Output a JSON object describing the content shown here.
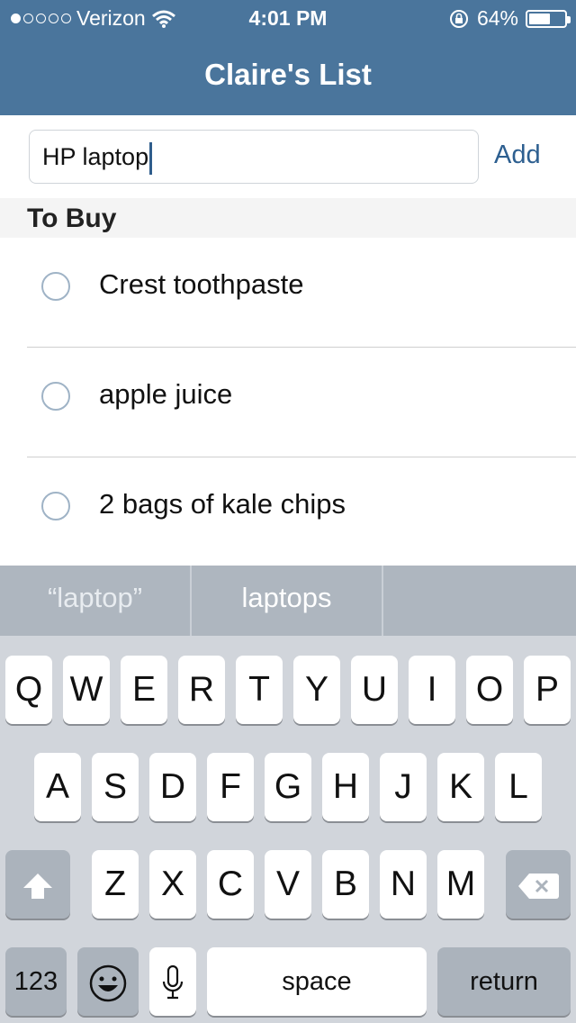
{
  "status": {
    "carrier": "Verizon",
    "signal_dots": [
      true,
      false,
      false,
      false,
      false
    ],
    "time": "4:01 PM",
    "battery_text": "64%",
    "battery_level": 0.64
  },
  "nav": {
    "title": "Claire's List"
  },
  "entry": {
    "value": "HP laptop",
    "add_label": "Add"
  },
  "section": {
    "title": "To Buy"
  },
  "items": [
    {
      "label": "Crest toothpaste"
    },
    {
      "label": "apple juice"
    },
    {
      "label": "2 bags of kale chips"
    }
  ],
  "keyboard": {
    "suggestions": [
      "“laptop”",
      "laptops",
      ""
    ],
    "row1": [
      "Q",
      "W",
      "E",
      "R",
      "T",
      "Y",
      "U",
      "I",
      "O",
      "P"
    ],
    "row2": [
      "A",
      "S",
      "D",
      "F",
      "G",
      "H",
      "J",
      "K",
      "L"
    ],
    "row3": [
      "Z",
      "X",
      "C",
      "V",
      "B",
      "N",
      "M"
    ],
    "numbers_label": "123",
    "space_label": "space",
    "return_label": "return"
  },
  "colors": {
    "nav": "#4a759c",
    "accent": "#2d5f90"
  },
  "icons": {
    "wifi": "wifi-icon",
    "lock_rotation": "rotation-lock-icon",
    "shift": "shift-icon",
    "backspace": "backspace-icon",
    "emoji": "emoji-icon",
    "mic": "microphone-icon"
  }
}
